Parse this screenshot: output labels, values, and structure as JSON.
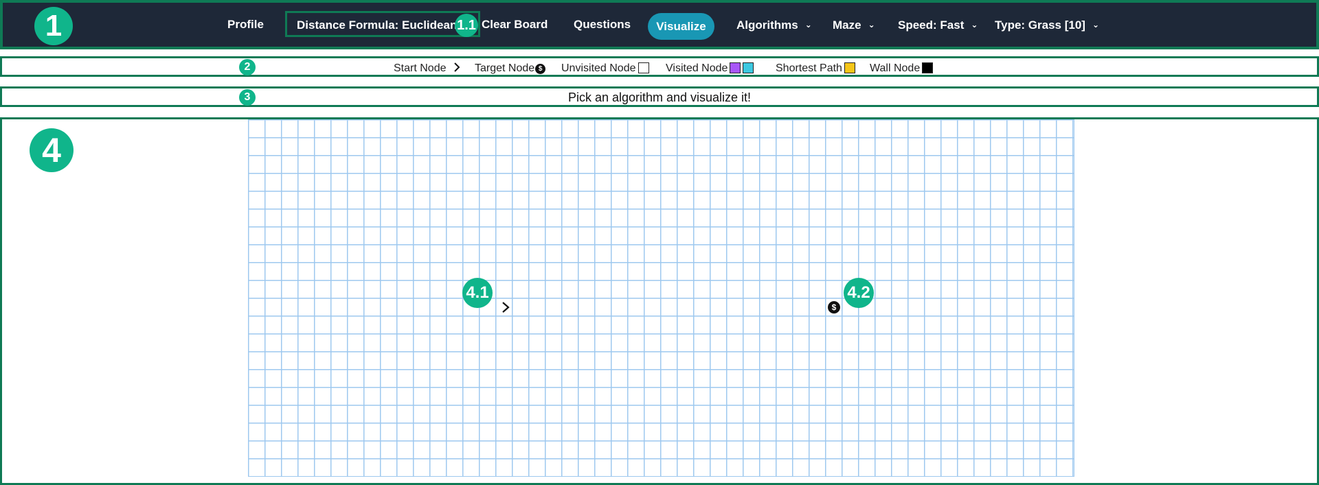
{
  "navbar": {
    "profile": "Profile",
    "distance_formula": "Distance Formula: Euclidean",
    "clear_board": "Clear Board",
    "questions": "Questions",
    "visualize": "Visualize",
    "algorithms": "Algorithms",
    "maze": "Maze",
    "speed": "Speed: Fast",
    "type": "Type: Grass [10]"
  },
  "legend": {
    "start_node": "Start Node",
    "target_node": "Target Node",
    "unvisited_node": "Unvisited Node",
    "visited_node": "Visited Node",
    "shortest_path": "Shortest Path",
    "wall_node": "Wall Node",
    "visited_colors": [
      "#a855f7",
      "#3cc8e0"
    ],
    "shortest_color": "#f5c518",
    "wall_color": "#000000",
    "unvisited_color": "#ffffff"
  },
  "message": "Pick an algorithm and visualize it!",
  "badges": {
    "b1": "1",
    "b11": "1.1",
    "b2": "2",
    "b3": "3",
    "b4": "4",
    "b41": "4.1",
    "b42": "4.2"
  },
  "icons": {
    "start": "chevron-right-icon",
    "target": "dollar-coin-icon"
  },
  "colors": {
    "navbar_bg": "#1e2838",
    "accent": "#1997b4",
    "badge": "#10b58b",
    "outline": "#0f7a55",
    "grid_line": "#9ec8ef"
  }
}
